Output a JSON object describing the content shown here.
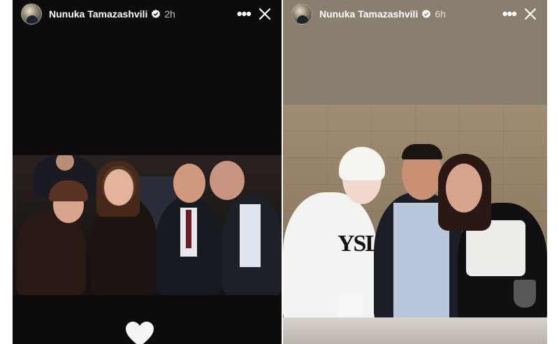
{
  "stories": [
    {
      "username": "Nunuka Tamazashvili",
      "time": "2h"
    },
    {
      "username": "Nunuka Tamazashvili",
      "time": "6h"
    }
  ],
  "photo_right": {
    "shirt_logo": "YSL"
  },
  "icons": {
    "more": "more-icon",
    "close": "close-icon",
    "verified": "verified-badge-icon",
    "like": "heart-icon"
  },
  "colors": {
    "left_background": "#0d0b0b",
    "right_background": "#8a7e6e",
    "text": "#ffffff"
  }
}
